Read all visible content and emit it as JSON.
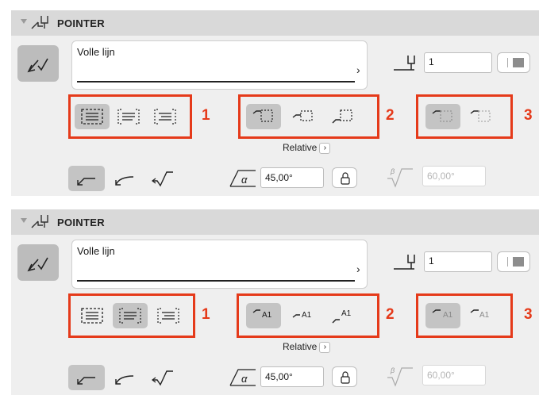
{
  "panels": [
    {
      "title": "POINTER",
      "line_type": "Volle lijn",
      "pen_number": "1",
      "group_labels": [
        "1",
        "2",
        "3"
      ],
      "group1_selected": 0,
      "group2_style": "box",
      "relative_label": "Relative",
      "angle_value": "45,00°",
      "angle2_value": "60,00°"
    },
    {
      "title": "POINTER",
      "line_type": "Volle lijn",
      "pen_number": "1",
      "group_labels": [
        "1",
        "2",
        "3"
      ],
      "group1_selected": 1,
      "group2_style": "text",
      "group2_text": "A1",
      "relative_label": "Relative",
      "angle_value": "45,00°",
      "angle2_value": "60,00°"
    }
  ],
  "colors": {
    "accent": "#e53a1a",
    "header_bg": "#d9d9d9",
    "panel_bg": "#efefef",
    "selected_bg": "#c4c4c4"
  }
}
